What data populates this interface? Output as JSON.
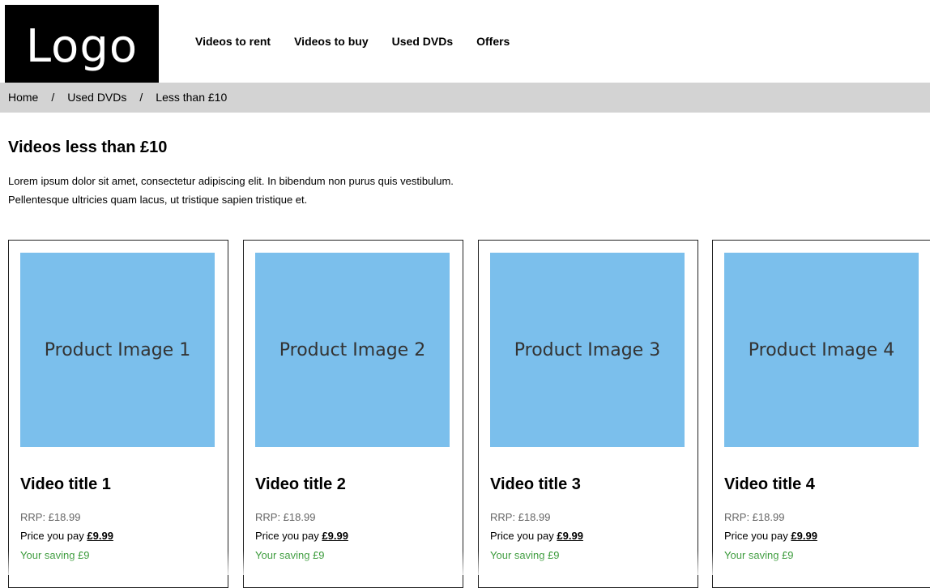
{
  "header": {
    "logo_text": "Logo",
    "nav": [
      {
        "label": "Videos to rent"
      },
      {
        "label": "Videos to buy"
      },
      {
        "label": "Used DVDs"
      },
      {
        "label": "Offers"
      }
    ]
  },
  "breadcrumb": {
    "items": [
      {
        "label": "Home"
      },
      {
        "label": "Used DVDs"
      },
      {
        "label": "Less than £10"
      }
    ],
    "separator": "/"
  },
  "main": {
    "title": "Videos less than £10",
    "intro": "Lorem ipsum dolor sit amet, consectetur adipiscing elit. In bibendum non purus quis vestibulum. Pellentesque ultricies quam lacus, ut tristique sapien tristique et."
  },
  "products": [
    {
      "image_label": "Product Image 1",
      "title": "Video title 1",
      "rrp": "RRP: £18.99",
      "pay_label": "Price you pay",
      "price": "£9.99",
      "saving": "Your saving £9"
    },
    {
      "image_label": "Product Image 2",
      "title": "Video title 2",
      "rrp": "RRP: £18.99",
      "pay_label": "Price you pay",
      "price": "£9.99",
      "saving": "Your saving £9"
    },
    {
      "image_label": "Product Image 3",
      "title": "Video title 3",
      "rrp": "RRP: £18.99",
      "pay_label": "Price you pay",
      "price": "£9.99",
      "saving": "Your saving £9"
    },
    {
      "image_label": "Product Image 4",
      "title": "Video title 4",
      "rrp": "RRP: £18.99",
      "pay_label": "Price you pay",
      "price": "£9.99",
      "saving": "Your saving £9"
    }
  ],
  "colors": {
    "logo_bg": "#000000",
    "breadcrumb_bg": "#d3d3d3",
    "product_image_bg": "#7bbfec",
    "saving_text": "#1a8a1a"
  }
}
